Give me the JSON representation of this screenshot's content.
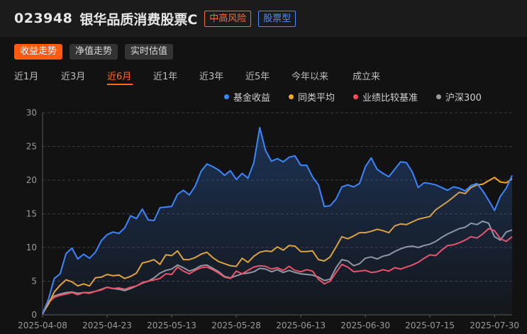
{
  "fund": {
    "code": "023948",
    "name": "银华品质消费股票C",
    "risk_tag": "中高风险",
    "type_tag": "股票型"
  },
  "view_tabs": [
    {
      "label": "收益走势",
      "active": true
    },
    {
      "label": "净值走势",
      "active": false
    },
    {
      "label": "实时估值",
      "active": false
    }
  ],
  "periods": [
    {
      "label": "近1月",
      "active": false
    },
    {
      "label": "近3月",
      "active": false
    },
    {
      "label": "近6月",
      "active": true
    },
    {
      "label": "近1年",
      "active": false
    },
    {
      "label": "近3年",
      "active": false
    },
    {
      "label": "近5年",
      "active": false
    },
    {
      "label": "今年以来",
      "active": false
    },
    {
      "label": "成立来",
      "active": false
    }
  ],
  "legend": [
    {
      "label": "基金收益",
      "color": "#3a86ff"
    },
    {
      "label": "同类平均",
      "color": "#f5a623"
    },
    {
      "label": "业绩比较基准",
      "color": "#ff4d5a"
    },
    {
      "label": "沪深300",
      "color": "#9a9a9a"
    }
  ],
  "chart_data": {
    "type": "line",
    "x": [
      "2025-04-08",
      "2025-04-09",
      "2025-04-10",
      "2025-04-11",
      "2025-04-14",
      "2025-04-15",
      "2025-04-16",
      "2025-04-17",
      "2025-04-18",
      "2025-04-21",
      "2025-04-22",
      "2025-04-23",
      "2025-04-24",
      "2025-04-25",
      "2025-04-28",
      "2025-04-29",
      "2025-04-30",
      "2025-05-06",
      "2025-05-07",
      "2025-05-08",
      "2025-05-09",
      "2025-05-12",
      "2025-05-13",
      "2025-05-14",
      "2025-05-15",
      "2025-05-16",
      "2025-05-19",
      "2025-05-20",
      "2025-05-21",
      "2025-05-22",
      "2025-05-23",
      "2025-05-26",
      "2025-05-27",
      "2025-05-28",
      "2025-05-29",
      "2025-05-30",
      "2025-06-03",
      "2025-06-04",
      "2025-06-05",
      "2025-06-06",
      "2025-06-09",
      "2025-06-10",
      "2025-06-11",
      "2025-06-12",
      "2025-06-13",
      "2025-06-16",
      "2025-06-17",
      "2025-06-18",
      "2025-06-19",
      "2025-06-20",
      "2025-06-23",
      "2025-06-24",
      "2025-06-25",
      "2025-06-26",
      "2025-06-27",
      "2025-06-30",
      "2025-07-01",
      "2025-07-02",
      "2025-07-03",
      "2025-07-04",
      "2025-07-07",
      "2025-07-08",
      "2025-07-09",
      "2025-07-10",
      "2025-07-11",
      "2025-07-14",
      "2025-07-15",
      "2025-07-16",
      "2025-07-17",
      "2025-07-18",
      "2025-07-21",
      "2025-07-22",
      "2025-07-23",
      "2025-07-24",
      "2025-07-25",
      "2025-07-28",
      "2025-07-29",
      "2025-07-30",
      "2025-07-31",
      "2025-08-01",
      "2025-08-04"
    ],
    "x_ticks": [
      "2025-04-08",
      "2025-04-23",
      "2025-05-13",
      "2025-05-28",
      "2025-06-13",
      "2025-06-30",
      "2025-07-15",
      "2025-07-30"
    ],
    "ylim": [
      0,
      30
    ],
    "y_ticks": [
      0,
      5,
      10,
      15,
      20,
      25,
      30
    ],
    "grid": true,
    "series": [
      {
        "name": "基金收益",
        "color": "#3a86ff",
        "area": true,
        "values": [
          0.2,
          2.3,
          5.4,
          6.1,
          9.1,
          9.9,
          8.3,
          9.0,
          8.4,
          9.3,
          11.0,
          11.9,
          12.3,
          12.1,
          12.9,
          14.7,
          14.3,
          15.7,
          14.1,
          14.0,
          15.9,
          16.0,
          16.1,
          17.9,
          18.5,
          17.8,
          19.1,
          21.3,
          22.4,
          22.0,
          21.5,
          20.7,
          21.4,
          20.1,
          21.0,
          20.3,
          22.6,
          27.8,
          24.4,
          22.8,
          23.2,
          22.7,
          23.4,
          23.6,
          22.2,
          22.2,
          20.5,
          19.3,
          16.1,
          16.2,
          17.2,
          19.0,
          19.3,
          19.0,
          19.5,
          22.0,
          23.3,
          21.6,
          21.0,
          20.5,
          21.6,
          22.7,
          22.6,
          21.2,
          18.9,
          19.6,
          19.5,
          19.3,
          18.9,
          18.5,
          19.0,
          18.8,
          18.4,
          19.2,
          19.5,
          18.4,
          17.0,
          15.5,
          17.6,
          18.8,
          20.7
        ]
      },
      {
        "name": "同类平均",
        "color": "#f5a623",
        "area": false,
        "values": [
          0.2,
          1.6,
          3.4,
          4.4,
          5.2,
          4.9,
          4.3,
          4.6,
          4.3,
          5.5,
          5.6,
          6.0,
          5.8,
          5.9,
          5.4,
          5.7,
          6.2,
          7.7,
          7.9,
          8.2,
          7.5,
          8.9,
          8.8,
          9.5,
          8.2,
          8.2,
          8.5,
          9.0,
          9.3,
          8.5,
          7.9,
          7.6,
          7.3,
          7.2,
          8.4,
          7.8,
          8.7,
          9.3,
          9.5,
          9.4,
          10.1,
          9.6,
          10.3,
          10.2,
          9.4,
          9.4,
          9.5,
          8.2,
          8.0,
          8.6,
          10.1,
          11.6,
          11.3,
          11.7,
          12.2,
          12.2,
          12.4,
          12.7,
          12.5,
          12.2,
          13.2,
          13.5,
          13.4,
          13.8,
          14.2,
          14.4,
          14.6,
          15.6,
          16.2,
          16.8,
          17.5,
          18.2,
          18.0,
          18.9,
          19.3,
          19.4,
          19.9,
          20.4,
          19.7,
          19.6,
          20.2
        ]
      },
      {
        "name": "业绩比较基准",
        "color": "#ff4d5a",
        "area": false,
        "values": [
          0.1,
          1.8,
          2.6,
          2.9,
          3.1,
          3.3,
          3.0,
          3.3,
          3.2,
          3.5,
          3.7,
          4.1,
          3.9,
          4.0,
          3.8,
          4.1,
          4.3,
          4.8,
          5.0,
          5.2,
          5.4,
          6.1,
          6.0,
          7.1,
          6.5,
          6.1,
          6.6,
          7.0,
          7.1,
          6.7,
          6.2,
          5.6,
          5.4,
          6.5,
          6.1,
          6.6,
          7.1,
          7.3,
          7.2,
          6.8,
          7.0,
          6.6,
          7.2,
          6.6,
          6.4,
          6.7,
          6.5,
          5.3,
          4.6,
          5.0,
          6.3,
          7.5,
          7.1,
          6.4,
          6.5,
          6.6,
          6.3,
          6.4,
          6.7,
          6.5,
          7.0,
          6.8,
          7.1,
          7.4,
          7.8,
          8.4,
          8.9,
          8.8,
          9.6,
          10.3,
          10.4,
          10.7,
          11.1,
          11.6,
          11.4,
          12.0,
          12.8,
          12.5,
          11.3,
          10.9,
          11.6
        ]
      },
      {
        "name": "沪深300",
        "color": "#9a9a9a",
        "area": false,
        "values": [
          0.1,
          1.9,
          2.8,
          3.1,
          3.3,
          3.4,
          3.2,
          3.3,
          3.3,
          3.5,
          3.8,
          4.1,
          3.9,
          3.8,
          3.6,
          3.9,
          4.3,
          4.7,
          5.0,
          5.5,
          6.2,
          6.6,
          6.8,
          7.4,
          7.0,
          6.5,
          6.8,
          7.3,
          7.4,
          6.9,
          6.4,
          5.7,
          5.5,
          5.8,
          6.1,
          6.2,
          6.4,
          6.9,
          6.8,
          6.4,
          6.7,
          6.3,
          6.6,
          6.3,
          6.1,
          6.0,
          5.9,
          5.6,
          5.1,
          5.3,
          7.0,
          8.2,
          8.0,
          7.3,
          7.6,
          8.4,
          8.6,
          8.3,
          8.7,
          8.9,
          9.4,
          9.8,
          10.1,
          10.2,
          10.0,
          10.3,
          10.5,
          10.9,
          11.5,
          12.0,
          12.4,
          12.8,
          13.0,
          13.6,
          13.4,
          13.9,
          13.6,
          11.6,
          11.1,
          12.3,
          12.6
        ]
      }
    ]
  }
}
